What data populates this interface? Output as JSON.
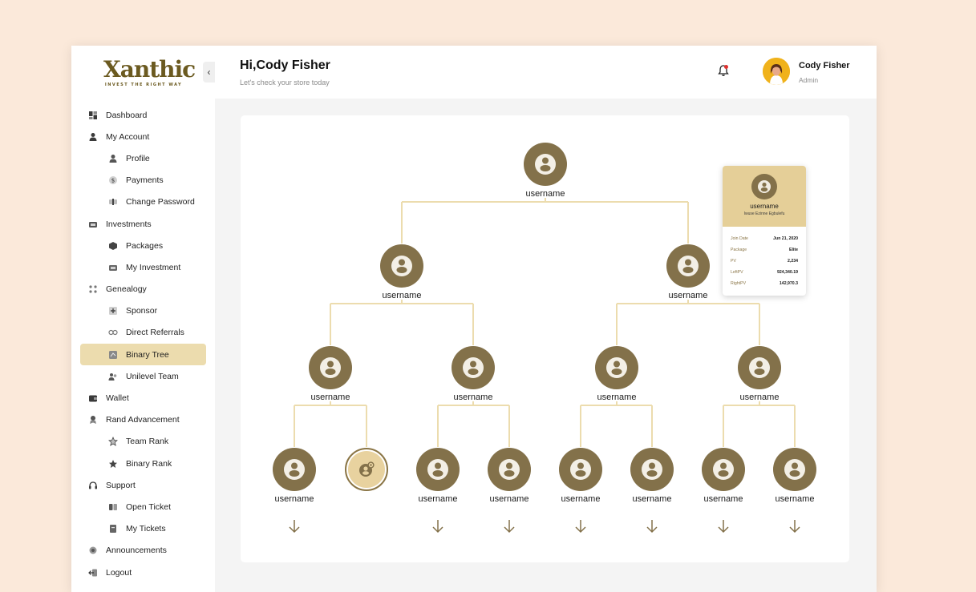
{
  "brand": {
    "name": "Xanthic",
    "tagline": "INVEST THE RIGHT WAY"
  },
  "sidebar": {
    "collapse_glyph": "‹",
    "items": [
      {
        "label": "Dashboard",
        "level": "top",
        "icon": "dashboard-icon"
      },
      {
        "label": "My Account",
        "level": "top",
        "icon": "user-icon"
      },
      {
        "label": "Profile",
        "level": "sub",
        "icon": "profile-icon"
      },
      {
        "label": "Payments",
        "level": "sub",
        "icon": "dollar-icon"
      },
      {
        "label": "Change Password",
        "level": "sub",
        "icon": "password-icon"
      },
      {
        "label": "Investments",
        "level": "top",
        "icon": "investments-icon"
      },
      {
        "label": "Packages",
        "level": "sub",
        "icon": "package-icon"
      },
      {
        "label": "My Investment",
        "level": "sub",
        "icon": "investment-icon"
      },
      {
        "label": "Genealogy",
        "level": "top",
        "icon": "genealogy-icon"
      },
      {
        "label": "Sponsor",
        "level": "sub",
        "icon": "sponsor-icon"
      },
      {
        "label": "Direct Referrals",
        "level": "sub",
        "icon": "referrals-icon"
      },
      {
        "label": "Binary Tree",
        "level": "sub",
        "icon": "binary-tree-icon",
        "active": true
      },
      {
        "label": "Unilevel Team",
        "level": "sub",
        "icon": "team-icon"
      },
      {
        "label": "Wallet",
        "level": "top",
        "icon": "wallet-icon"
      },
      {
        "label": "Rand Advancement",
        "level": "top",
        "icon": "rank-icon"
      },
      {
        "label": "Team Rank",
        "level": "sub",
        "icon": "star-outline-icon"
      },
      {
        "label": "Binary Rank",
        "level": "sub",
        "icon": "star-icon"
      },
      {
        "label": "Support",
        "level": "top",
        "icon": "headset-icon"
      },
      {
        "label": "Open Ticket",
        "level": "sub",
        "icon": "ticket-icon"
      },
      {
        "label": "My Tickets",
        "level": "sub",
        "icon": "tickets-icon"
      },
      {
        "label": "Announcements",
        "level": "top",
        "icon": "announcement-icon"
      },
      {
        "label": "Logout",
        "level": "top",
        "icon": "logout-icon"
      }
    ]
  },
  "header": {
    "greeting": "Hi,Cody Fisher",
    "subtitle": "Let's check your store today",
    "user_name": "Cody Fisher",
    "user_role": "Admin"
  },
  "tree": {
    "node_label": "username",
    "nodes": [
      "username",
      "username",
      "username",
      "username",
      "username",
      "username",
      "username",
      "username",
      "username",
      "username",
      "username",
      "username",
      "username",
      "username"
    ]
  },
  "popover": {
    "name": "username",
    "subname": "Iwuse Ezinne Egbulefu",
    "rows": [
      {
        "key": "Join Date",
        "value": "Jun 21, 2020"
      },
      {
        "key": "Package",
        "value": "Elite"
      },
      {
        "key": "PV",
        "value": "2,234"
      },
      {
        "key": "LeftPV",
        "value": "924,340.19"
      },
      {
        "key": "RightPV",
        "value": "142,970.3"
      }
    ]
  },
  "colors": {
    "accent": "#83714a",
    "active_bg": "#ecdcae",
    "connector": "#ecdcae",
    "popover_head": "#e5cf98",
    "background": "#fbe9da"
  }
}
